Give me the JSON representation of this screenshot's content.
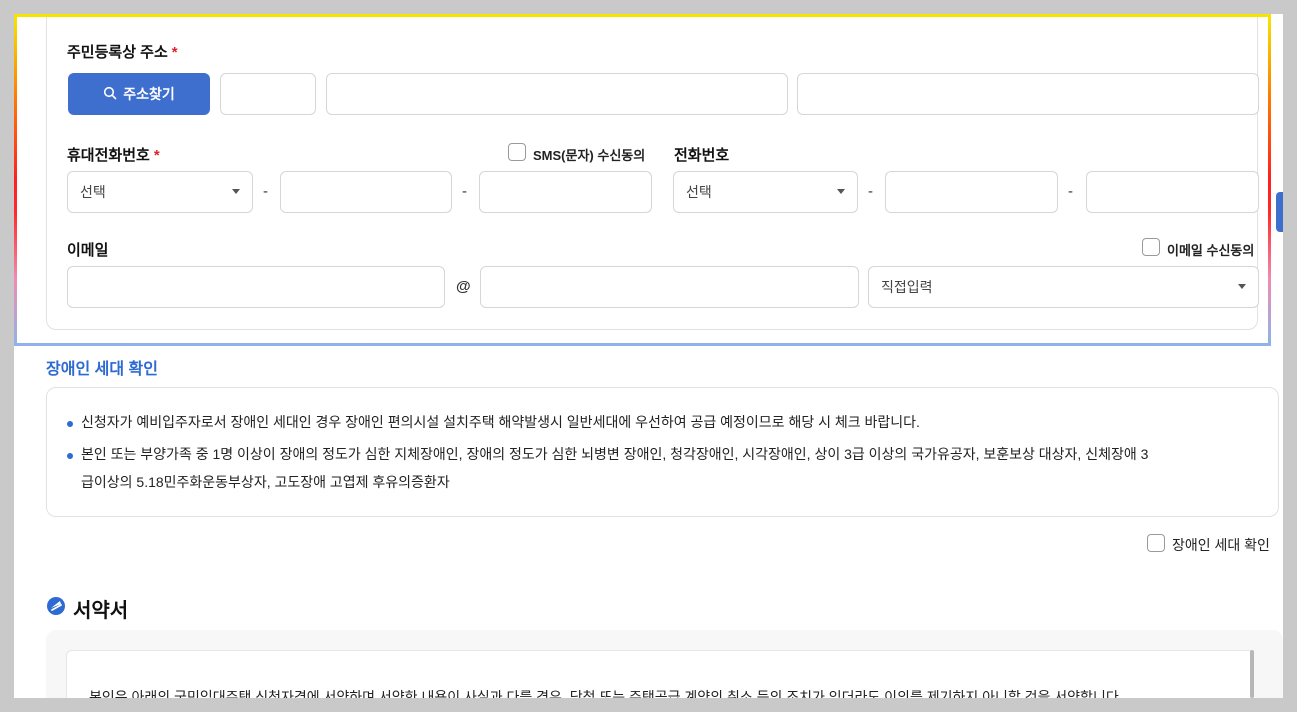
{
  "address": {
    "label": "주민등록상 주소",
    "required_mark": "*",
    "search_button": "주소찾기",
    "postcode_value": "",
    "address1_value": "",
    "address2_value": ""
  },
  "mobile": {
    "label": "휴대전화번호",
    "required_mark": "*",
    "carrier_select": "선택",
    "separator": "-",
    "sms_consent_label": "SMS(문자) 수신동의"
  },
  "phone": {
    "label": "전화번호",
    "area_select": "선택",
    "separator": "-"
  },
  "email": {
    "label": "이메일",
    "consent_label": "이메일 수신동의",
    "at": "@",
    "domain_select": "직접입력"
  },
  "disability": {
    "title": "장애인 세대 확인",
    "notices": [
      "신청자가 예비입주자로서 장애인 세대인 경우 장애인 편의시설 설치주택 해약발생시 일반세대에 우선하여 공급 예정이므로 해당 시 체크 바랍니다.",
      "본인 또는 부양가족 중 1명 이상이 장애의 정도가 심한 지체장애인, 장애의 정도가 심한 뇌병변 장애인, 청각장애인, 시각장애인, 상이 3급 이상의 국가유공자, 보훈보상 대상자, 신체장애 3",
      "급이상의 5.18민주화운동부상자, 고도장애 고엽제 후유의증환자"
    ],
    "checkbox_label": "장애인 세대 확인"
  },
  "oath": {
    "title": "서약서",
    "text": "본인은 아래의 국민임대주택 신청자격에 서약하며 서약한 내용이 사실과 다를 경우, 당첨 또는 주택공급 계약의 취소 등의 조치가 있더라도 이의를 제기하지 아니할 것을 서약합니다."
  },
  "colors": {
    "primary": "#3f6fce",
    "section_title": "#2d6ad1",
    "required": "#e0202a"
  }
}
